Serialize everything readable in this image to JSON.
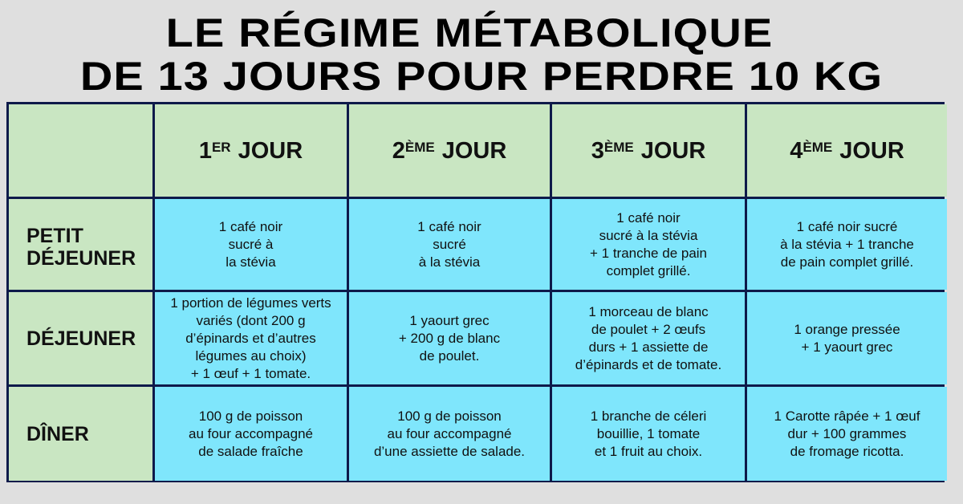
{
  "title": {
    "line1": "LE RÉGIME MÉTABOLIQUE",
    "line2": "DE 13 JOURS POUR PERDRE 10 KG"
  },
  "days": [
    {
      "num": "1",
      "sup": "ER",
      "label": "JOUR"
    },
    {
      "num": "2",
      "sup": "ÈME",
      "label": "JOUR"
    },
    {
      "num": "3",
      "sup": "ÈME",
      "label": "JOUR"
    },
    {
      "num": "4",
      "sup": "ÈME",
      "label": "JOUR"
    }
  ],
  "meals": [
    {
      "label": "PETIT\nDÉJEUNER",
      "cells": [
        "1 café noir\nsucré à\nla stévia",
        "1 café noir\nsucré\nà la stévia",
        "1 café noir\nsucré à la stévia\n+ 1 tranche de pain\ncomplet grillé.",
        "1 café noir sucré\nà la stévia + 1 tranche\nde pain complet grillé."
      ]
    },
    {
      "label": "DÉJEUNER",
      "cells": [
        "1 portion de légumes verts\nvariés (dont 200 g\nd’épinards et d’autres\nlégumes au choix)\n+ 1 œuf + 1 tomate.",
        "1 yaourt grec\n+ 200 g de blanc\nde poulet.",
        "1 morceau de blanc\nde poulet + 2 œufs\ndurs + 1 assiette de\nd’épinards et de tomate.",
        "1 orange pressée\n+ 1 yaourt grec"
      ]
    },
    {
      "label": "DÎNER",
      "cells": [
        "100 g de poisson\nau four accompagné\nde salade fraîche",
        "100 g de poisson\nau four accompagné\nd’une assiette de salade.",
        "1 branche de céleri\nbouillie,  1 tomate\net 1 fruit au choix.",
        "1 Carotte râpée + 1 œuf\ndur + 100 grammes\nde fromage ricotta."
      ]
    }
  ],
  "colors": {
    "header_bg": "#c9e6c2",
    "body_bg": "#7fe6fc",
    "border": "#0e1a4a",
    "page_bg": "#dfdfdf"
  }
}
